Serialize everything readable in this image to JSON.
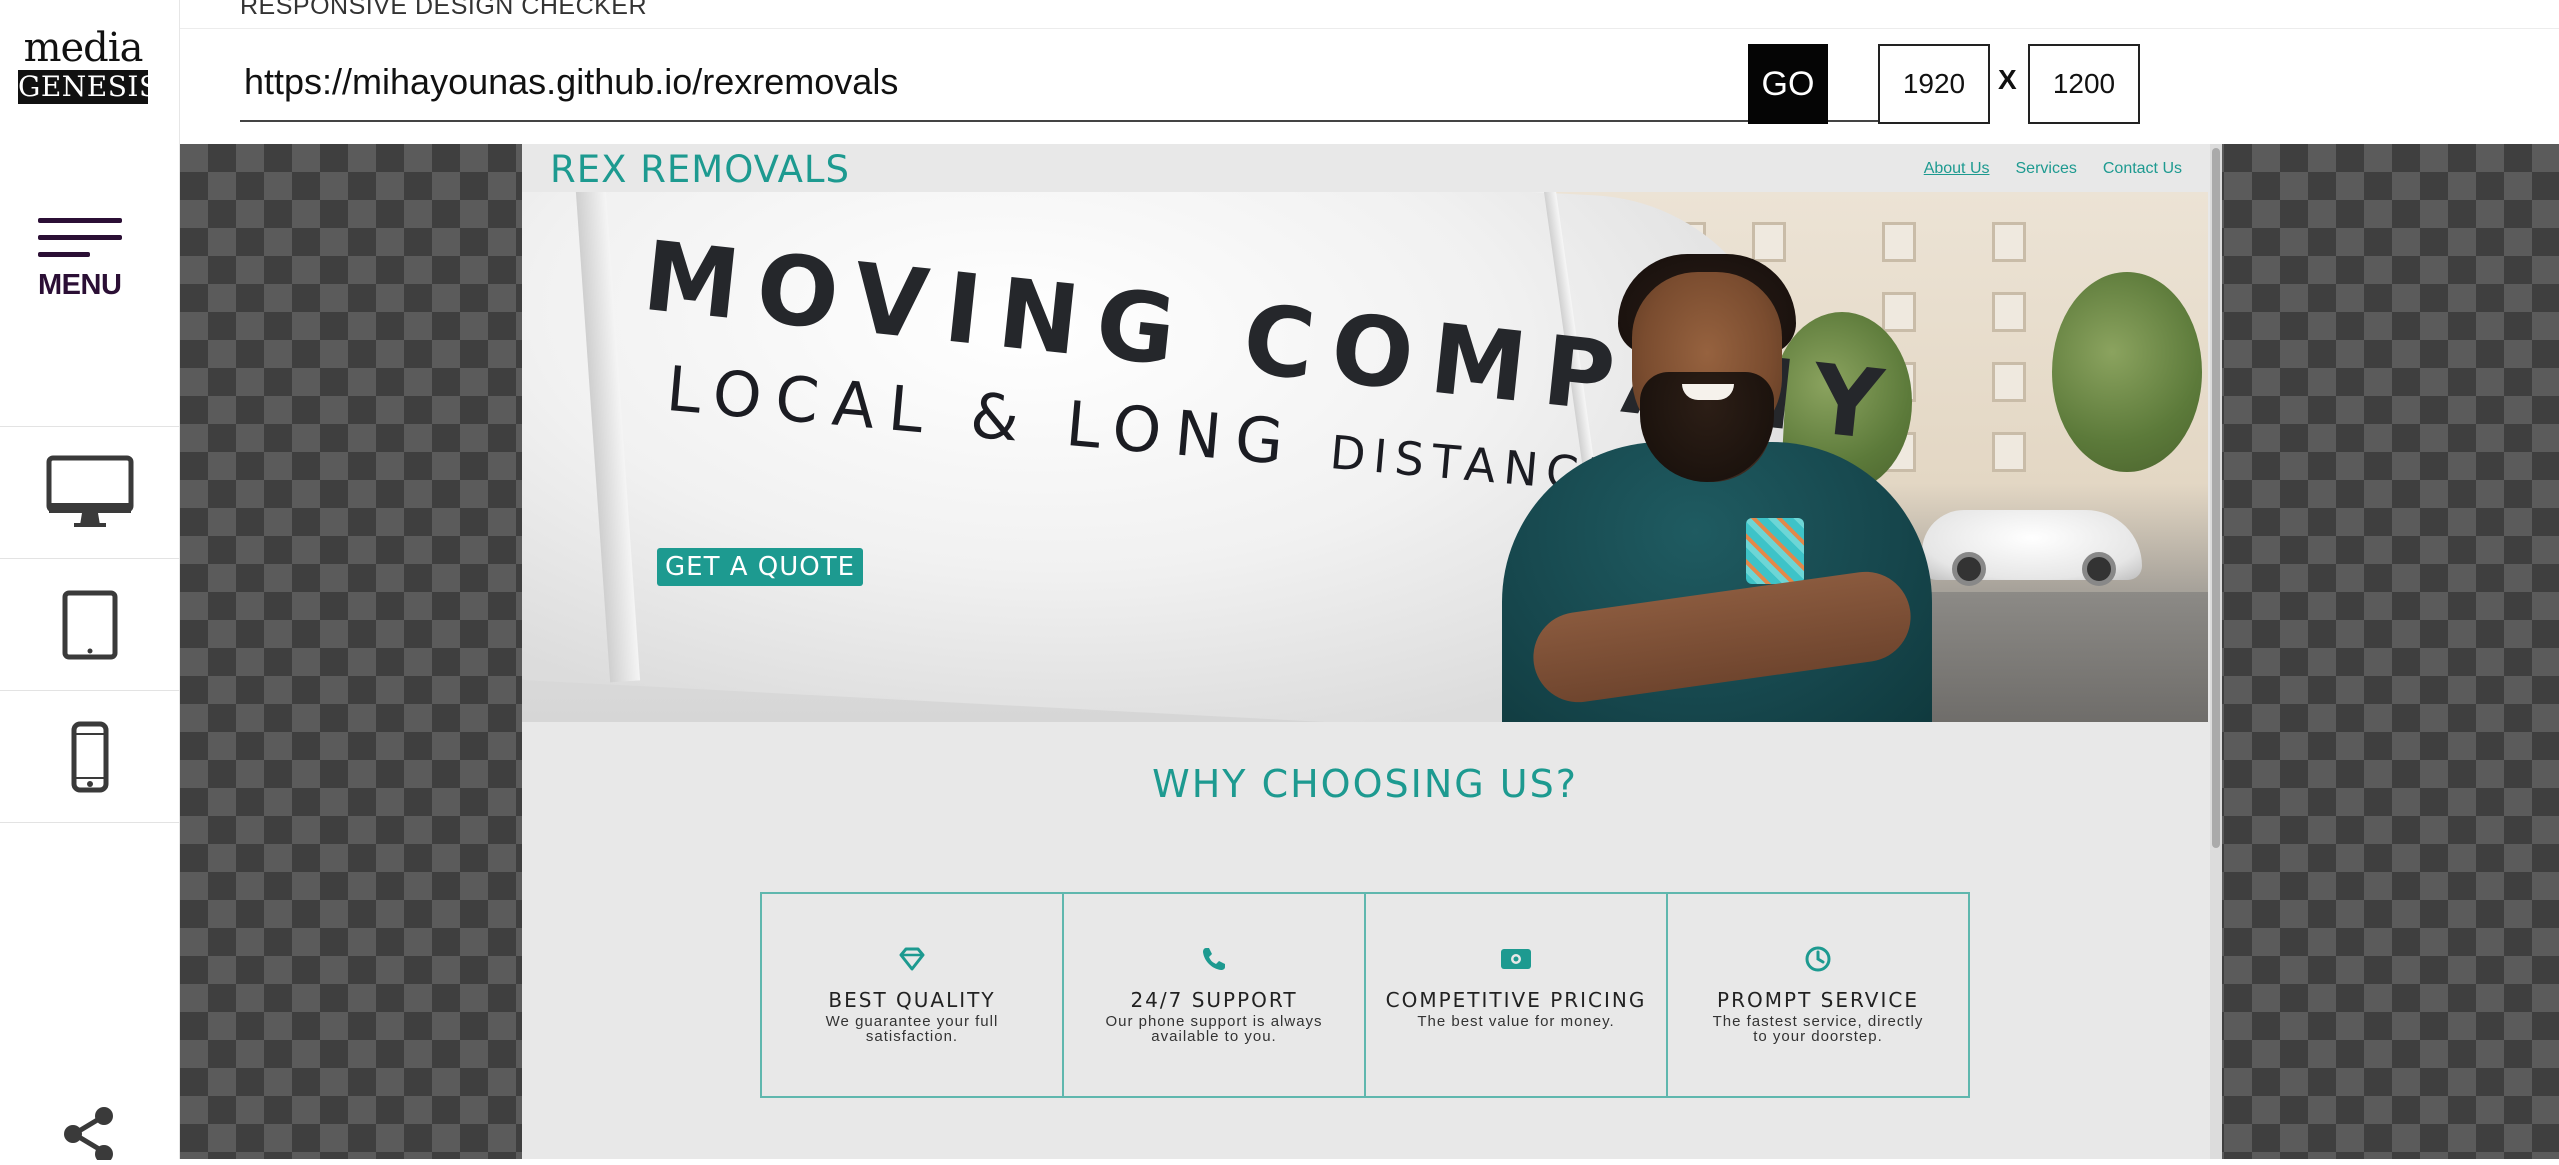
{
  "app": {
    "logo_top": "media",
    "logo_bottom": "GENESIS",
    "title": "RESPONSIVE DESIGN CHECKER",
    "menu_label": "MENU"
  },
  "sidebar": {
    "devices": [
      {
        "icon": "desktop-icon"
      },
      {
        "icon": "tablet-icon"
      },
      {
        "icon": "phone-icon"
      }
    ],
    "share_icon": "share-icon"
  },
  "toolbar": {
    "url_value": "https://mihayounas.github.io/rexremovals",
    "go_label": "GO",
    "width_value": "1920",
    "height_value": "1200",
    "separator": "X"
  },
  "site": {
    "brand": "REX REMOVALS",
    "nav": [
      {
        "label": "About Us",
        "active": true
      },
      {
        "label": "Services",
        "active": false
      },
      {
        "label": "Contact Us",
        "active": false
      }
    ],
    "hero": {
      "van_line1": "MOVING COMPANY",
      "van_line2_a": "LOCAL & LONG ",
      "van_line2_b": "DISTANCE",
      "cta": "GET A QUOTE"
    },
    "why_title": "WHY CHOOSING US?",
    "features": [
      {
        "icon": "diamond-icon",
        "title": "BEST QUALITY",
        "desc": "We guarantee your full satisfaction."
      },
      {
        "icon": "phone-icon",
        "title": "24/7 SUPPORT",
        "desc": "Our phone support is always available to you."
      },
      {
        "icon": "money-icon",
        "title": "COMPETITIVE PRICING",
        "desc": "The best value for money."
      },
      {
        "icon": "clock-icon",
        "title": "PROMPT SERVICE",
        "desc": "The fastest service, directly to your doorstep."
      }
    ]
  },
  "colors": {
    "accent": "#1d9a90",
    "menu": "#2b0f35",
    "checker_dark": "#3f3f3f",
    "checker_light": "#5b5b5b"
  }
}
